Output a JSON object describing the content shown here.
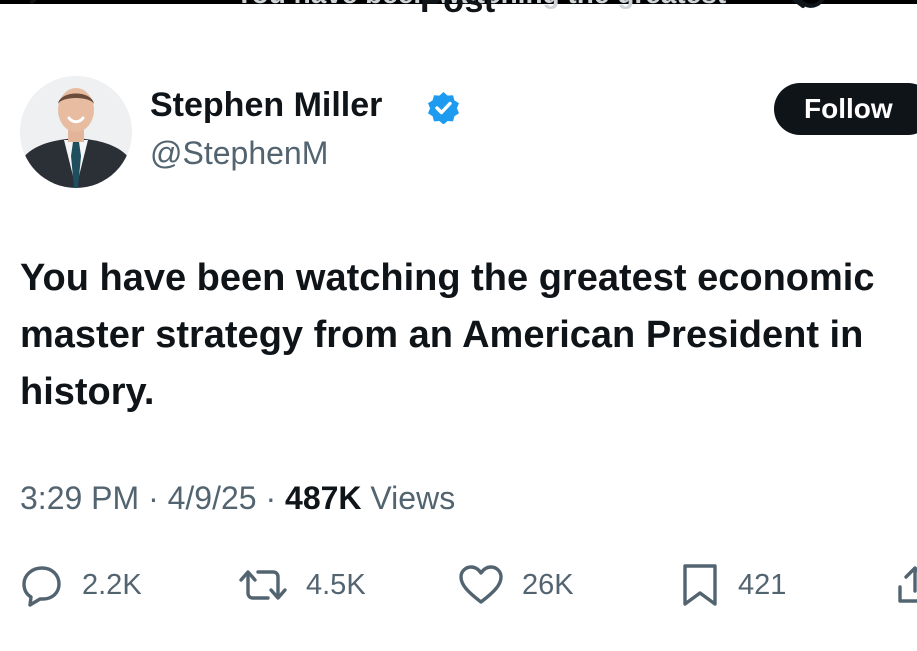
{
  "header": {
    "title": "Post",
    "ghost_text": "You have been watching the greatest",
    "back_icon": "arrow-left-icon",
    "refresh_icon": "refresh-icon"
  },
  "author": {
    "display_name": "Stephen Miller",
    "handle": "@StephenM",
    "verified_icon": "verified-badge-icon",
    "verified_color": "#1d9bf0"
  },
  "follow": {
    "label": "Follow"
  },
  "tweet": {
    "text": "You have been watching the greatest economic master strategy from an American President in history."
  },
  "meta": {
    "time": "3:29 PM",
    "separator": "·",
    "date": "4/9/25",
    "views_count": "487K",
    "views_label": "Views"
  },
  "actions": {
    "reply_count": "2.2K",
    "retweet_count": "4.5K",
    "like_count": "26K",
    "bookmark_count": "421"
  },
  "colors": {
    "text_primary": "#0f1419",
    "text_secondary": "#536471",
    "follow_bg": "#0f1419",
    "follow_text": "#ffffff"
  }
}
